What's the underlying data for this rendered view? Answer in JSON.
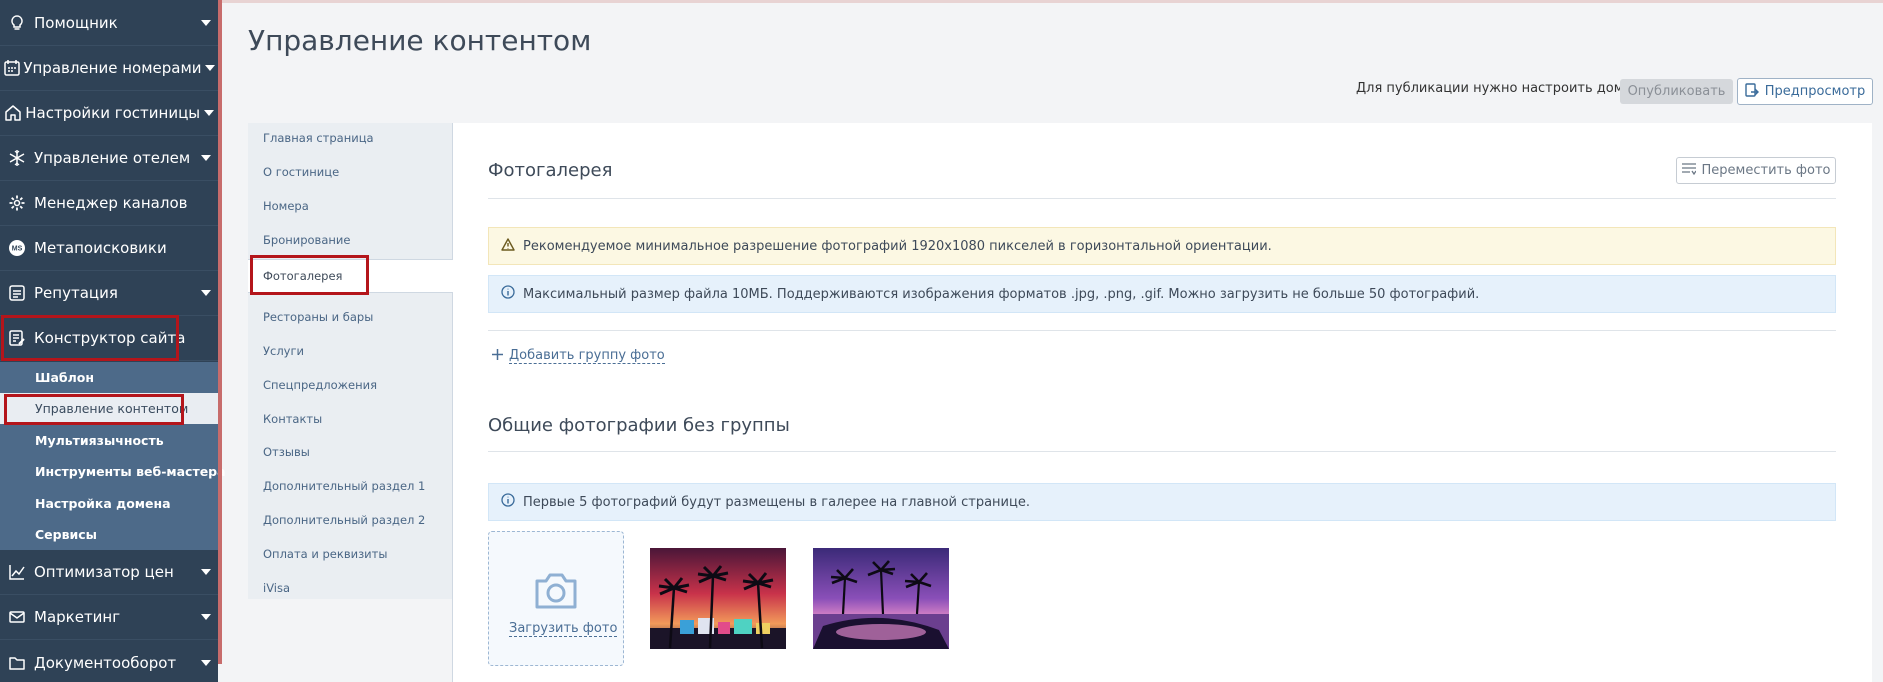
{
  "sidebar": {
    "items": [
      {
        "label": "Помощник",
        "icon": "lightbulb-icon",
        "caret": true
      },
      {
        "label": "Управление номерами",
        "icon": "calendar-icon",
        "caret": true
      },
      {
        "label": "Настройки гостиницы",
        "icon": "home-icon",
        "caret": true
      },
      {
        "label": "Управление отелем",
        "icon": "snowflake-icon",
        "caret": true
      },
      {
        "label": "Менеджер каналов",
        "icon": "gear-icon",
        "caret": false
      },
      {
        "label": "Метапоисковики",
        "icon": "ms-badge-icon",
        "caret": false
      },
      {
        "label": "Репутация",
        "icon": "reputation-icon",
        "caret": true
      },
      {
        "label": "Конструктор сайта",
        "icon": "site-builder-icon",
        "caret": false
      },
      {
        "label": "Оптимизатор цен",
        "icon": "chart-line-icon",
        "caret": true
      },
      {
        "label": "Маркетинг",
        "icon": "mail-icon",
        "caret": true
      },
      {
        "label": "Документооборот",
        "icon": "folder-icon",
        "caret": true
      }
    ],
    "ms_badge": "MS",
    "sub_items": [
      "Шаблон",
      "Управление контентом",
      "Мультиязычность",
      "Инструменты веб-мастера",
      "Настройка домена",
      "Сервисы"
    ]
  },
  "header": {
    "title": "Управление контентом",
    "domain_note": "Для публикации нужно настроить домен",
    "publish_label": "Опубликовать",
    "preview_label": "Предпросмотр"
  },
  "section_menu": {
    "items": [
      "Главная страница",
      "О гостинице",
      "Номера",
      "Бронирование",
      "Фотогалерея",
      "Рестораны и бары",
      "Услуги",
      "Спецпредложения",
      "Контакты",
      "Отзывы",
      "Дополнительный раздел 1",
      "Дополнительный раздел 2",
      "Оплата и реквизиты",
      "iVisa"
    ],
    "active": "Фотогалерея"
  },
  "gallery": {
    "title": "Фотогалерея",
    "move_label": "Переместить фото",
    "warning": "Рекомендуемое минимальное разрешение фотографий 1920x1080 пикселей в горизонтальной ориентации.",
    "info": "Максимальный размер файла 10МБ. Поддерживаются изображения форматов .jpg, .png, .gif. Можно загрузить не больше 50 фотографий.",
    "add_group_label": "Добавить группу фото",
    "common_title": "Общие фотографии без группы",
    "common_info": "Первые 5 фотографий будут размещены в галерее на главной странице.",
    "upload_label": "Загрузить фото"
  },
  "colors": {
    "sidebar_bg": "#2f4256",
    "submenu_bg": "#4d6a89",
    "highlight": "#b4151b",
    "link": "#4a6e95"
  }
}
